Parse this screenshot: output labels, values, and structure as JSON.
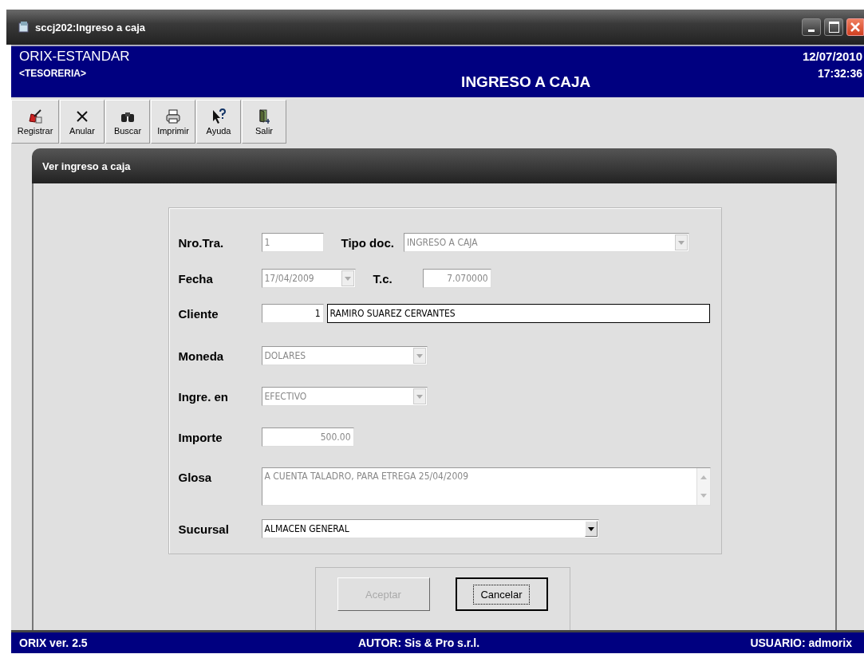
{
  "window": {
    "title": "sccj202:Ingreso a caja"
  },
  "header": {
    "company": "ORIX-ESTANDAR",
    "module": "<TESORERIA>",
    "screen_title": "INGRESO A CAJA",
    "date": "12/07/2010",
    "time": "17:32:36"
  },
  "toolbar": [
    {
      "label": "Registrar"
    },
    {
      "label": "Anular"
    },
    {
      "label": "Buscar"
    },
    {
      "label": "Imprimir"
    },
    {
      "label": "Ayuda"
    },
    {
      "label": "Salir"
    }
  ],
  "panel": {
    "title": "Ver ingreso a caja",
    "rows": [
      [
        {
          "kind": "label",
          "text": "Nro.Tra."
        },
        {
          "kind": "text",
          "value": "1",
          "disabled": true
        },
        {
          "kind": "label",
          "text": "Tipo doc."
        },
        {
          "kind": "combo",
          "value": "INGRESO A CAJA",
          "disabled": true
        }
      ],
      [
        {
          "kind": "label",
          "text": "Fecha"
        },
        {
          "kind": "combo",
          "value": "17/04/2009",
          "disabled": true
        },
        {
          "kind": "label",
          "text": "T.c."
        },
        {
          "kind": "text",
          "value": "7.070000",
          "disabled": true
        }
      ],
      [
        {
          "kind": "label",
          "text": "Cliente"
        },
        {
          "kind": "text",
          "value": "1",
          "disabled": false
        },
        {
          "kind": "text",
          "value": "RAMIRO SUAREZ CERVANTES",
          "disabled": false
        }
      ],
      [
        {
          "kind": "label",
          "text": "Moneda"
        },
        {
          "kind": "combo",
          "value": "DOLARES",
          "disabled": true
        }
      ],
      [
        {
          "kind": "label",
          "text": "Ingre. en"
        },
        {
          "kind": "combo",
          "value": "EFECTIVO",
          "disabled": true
        }
      ],
      [
        {
          "kind": "label",
          "text": "Importe"
        },
        {
          "kind": "text",
          "value": "500.00",
          "disabled": true
        }
      ],
      [
        {
          "kind": "label",
          "text": "Glosa"
        },
        {
          "kind": "memo",
          "value": "A CUENTA TALADRO, PARA ETREGA 25/04/2009",
          "disabled": true
        }
      ],
      [
        {
          "kind": "label",
          "text": "Sucursal"
        },
        {
          "kind": "combo",
          "value": "ALMACEN GENERAL",
          "disabled": false
        }
      ]
    ],
    "buttons": [
      {
        "label": "Aceptar",
        "disabled": true
      },
      {
        "label": "Cancelar",
        "disabled": false
      }
    ]
  },
  "status_bar": {
    "version": "ORIX ver. 2.5",
    "author": "AUTOR: Sis & Pro s.r.l.",
    "user": "USUARIO: admorix"
  }
}
